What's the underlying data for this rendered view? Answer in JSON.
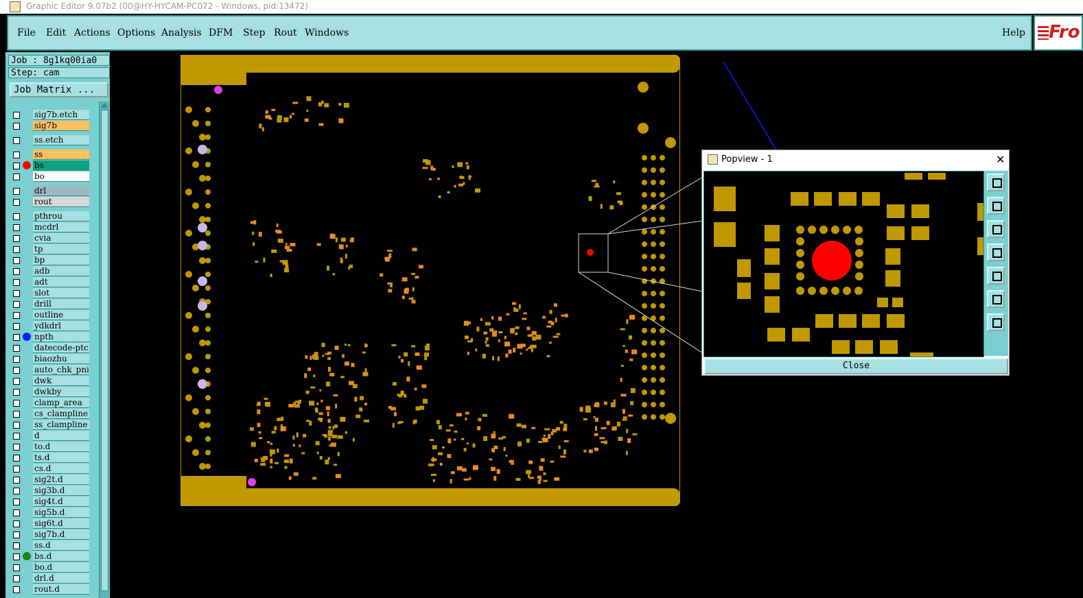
{
  "window": {
    "title": "Graphic Editor 9.07b2 (00@HY-HYCAM-PC072 - Windows, pid:13472)"
  },
  "menu": {
    "items": [
      "File",
      "Edit",
      "Actions",
      "Options",
      "Analysis",
      "DFM",
      "Step",
      "Rout",
      "Windows"
    ],
    "help": "Help",
    "logo": "Fro"
  },
  "job": {
    "job_label": "Job : 8g1kq00ia0",
    "step_label": "Step: cam",
    "matrix_button": "Job Matrix ..."
  },
  "layers": [
    {
      "name": "sig7b.etch",
      "color": "#a6e0e0",
      "dot": ""
    },
    {
      "name": "sig7b",
      "color": "#ffc060",
      "dot": ""
    },
    {
      "name": "ss.etch",
      "color": "#a6e0e0",
      "dot": ""
    },
    {
      "name": "ss",
      "color": "#ffc060",
      "dot": ""
    },
    {
      "name": "bs",
      "color": "#10a080",
      "dot": "#ff0000"
    },
    {
      "name": "bo",
      "color": "#ffffff",
      "dot": ""
    },
    {
      "name": "drl",
      "color": "#a0b8c0",
      "dot": ""
    },
    {
      "name": "rout",
      "color": "#d8d8d8",
      "dot": ""
    },
    {
      "name": "pthrou",
      "color": "#a6e0e0",
      "dot": ""
    },
    {
      "name": "mcdrl",
      "color": "#a6e0e0",
      "dot": ""
    },
    {
      "name": "cvia",
      "color": "#a6e0e0",
      "dot": ""
    },
    {
      "name": "tp",
      "color": "#a6e0e0",
      "dot": ""
    },
    {
      "name": "bp",
      "color": "#a6e0e0",
      "dot": ""
    },
    {
      "name": "adb",
      "color": "#a6e0e0",
      "dot": ""
    },
    {
      "name": "adt",
      "color": "#a6e0e0",
      "dot": ""
    },
    {
      "name": "slot",
      "color": "#a6e0e0",
      "dot": ""
    },
    {
      "name": "drill",
      "color": "#a6e0e0",
      "dot": ""
    },
    {
      "name": "outline",
      "color": "#a6e0e0",
      "dot": ""
    },
    {
      "name": "ydkdrl",
      "color": "#a6e0e0",
      "dot": ""
    },
    {
      "name": "npth",
      "color": "#a6e0e0",
      "dot": "#0020ff"
    },
    {
      "name": "datecode-ptc",
      "color": "#a6e0e0",
      "dot": ""
    },
    {
      "name": "biaozhu",
      "color": "#a6e0e0",
      "dot": ""
    },
    {
      "name": "auto_chk_pni",
      "color": "#a6e0e0",
      "dot": ""
    },
    {
      "name": "dwk",
      "color": "#a6e0e0",
      "dot": ""
    },
    {
      "name": "dwkby",
      "color": "#a6e0e0",
      "dot": ""
    },
    {
      "name": "clamp_area",
      "color": "#a6e0e0",
      "dot": ""
    },
    {
      "name": "cs_clampline",
      "color": "#a6e0e0",
      "dot": ""
    },
    {
      "name": "ss_clampline",
      "color": "#a6e0e0",
      "dot": ""
    },
    {
      "name": "d",
      "color": "#a6e0e0",
      "dot": ""
    },
    {
      "name": "to.d",
      "color": "#a6e0e0",
      "dot": ""
    },
    {
      "name": "ts.d",
      "color": "#a6e0e0",
      "dot": ""
    },
    {
      "name": "cs.d",
      "color": "#a6e0e0",
      "dot": ""
    },
    {
      "name": "sig2t.d",
      "color": "#a6e0e0",
      "dot": ""
    },
    {
      "name": "sig3b.d",
      "color": "#a6e0e0",
      "dot": ""
    },
    {
      "name": "sig4t.d",
      "color": "#a6e0e0",
      "dot": ""
    },
    {
      "name": "sig5b.d",
      "color": "#a6e0e0",
      "dot": ""
    },
    {
      "name": "sig6t.d",
      "color": "#a6e0e0",
      "dot": ""
    },
    {
      "name": "sig7b.d",
      "color": "#a6e0e0",
      "dot": ""
    },
    {
      "name": "ss.d",
      "color": "#a6e0e0",
      "dot": ""
    },
    {
      "name": "bs.d",
      "color": "#a6e0e0",
      "dot": "#208020"
    },
    {
      "name": "bo.d",
      "color": "#a6e0e0",
      "dot": ""
    },
    {
      "name": "drl.d",
      "color": "#a6e0e0",
      "dot": ""
    },
    {
      "name": "rout.d",
      "color": "#a6e0e0",
      "dot": ""
    }
  ],
  "popview": {
    "title": "Popview - 1",
    "close_label": "Close",
    "close_x": "✕"
  },
  "colors": {
    "pad": "#c09800",
    "pad_orange": "#e88a20",
    "board": "#c09800",
    "highlight": "#ff0000",
    "arrow": "#1010c0"
  }
}
